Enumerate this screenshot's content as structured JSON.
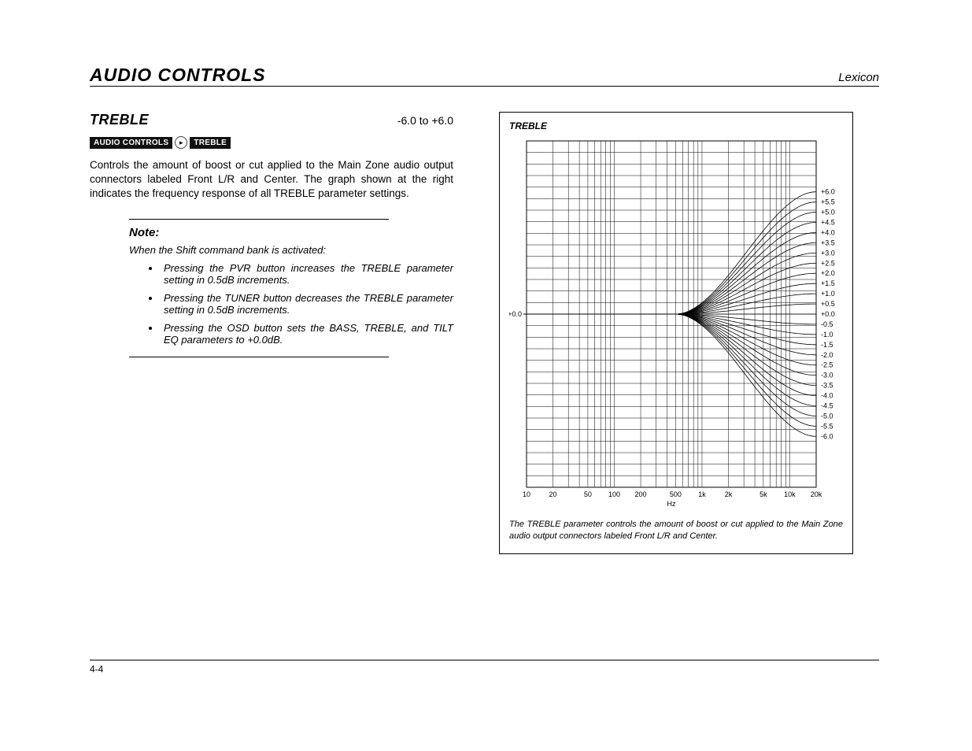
{
  "header": {
    "section": "AUDIO CONTROLS",
    "brand": "Lexicon"
  },
  "param": {
    "name": "TREBLE",
    "range": "-6.0 to +6.0"
  },
  "breadcrumb": {
    "a": "AUDIO CONTROLS",
    "arrow": "▸",
    "b": "TREBLE"
  },
  "body": "Controls the amount of boost or cut applied to the Main Zone audio output connectors labeled Front L/R and Center. The graph shown at the right indicates the frequency response of all TREBLE parameter settings.",
  "note": {
    "title": "Note:",
    "sub": "When the Shift command bank is activated:",
    "items": [
      "Pressing the PVR button increases the TREBLE parameter setting in 0.5dB increments.",
      "Pressing the TUNER button decreases the TREBLE parameter setting in 0.5dB increments.",
      "Pressing the OSD button sets the BASS, TREBLE, and TILT EQ parameters to +0.0dB."
    ]
  },
  "figure": {
    "title": "TREBLE",
    "caption": "The TREBLE parameter controls the amount of boost or cut applied to the Main Zone audio output connectors labeled Front L/R and Center."
  },
  "footer": {
    "page": "4-4"
  },
  "chart_data": {
    "type": "line",
    "title": "TREBLE",
    "xlabel": "Hz",
    "x_scale": "log",
    "x_ticks": [
      10,
      20,
      50,
      100,
      200,
      500,
      1000,
      2000,
      5000,
      10000,
      20000
    ],
    "x_tick_labels": [
      "10",
      "20",
      "50",
      "100",
      "200",
      "500",
      "1k",
      "2k",
      "5k",
      "10k",
      "20k"
    ],
    "xlim": [
      10,
      20000
    ],
    "ylabel": "",
    "left_y_tick": "+0.0",
    "right_y_ticks": [
      "+6.0",
      "+5.5",
      "+5.0",
      "+4.5",
      "+4.0",
      "+3.5",
      "+3.0",
      "+2.5",
      "+2.0",
      "+1.5",
      "+1.0",
      "+0.5",
      "+0.0",
      "-0.5",
      "-1.0",
      "-1.5",
      "-2.0",
      "-2.5",
      "-3.0",
      "-3.5",
      "-4.0",
      "-4.5",
      "-5.0",
      "-5.5",
      "-6.0"
    ],
    "ylim_db": [
      -6.0,
      6.0
    ],
    "series_description": "25 frequency-response curves corresponding to TREBLE settings from -6.0 dB to +6.0 dB in 0.5 dB steps. Each curve is ~0 dB below ~500 Hz and shelves to its setting value by 20 kHz.",
    "series": [
      {
        "name": "+6.0",
        "gain_at_20k_db": 6.0
      },
      {
        "name": "+5.5",
        "gain_at_20k_db": 5.5
      },
      {
        "name": "+5.0",
        "gain_at_20k_db": 5.0
      },
      {
        "name": "+4.5",
        "gain_at_20k_db": 4.5
      },
      {
        "name": "+4.0",
        "gain_at_20k_db": 4.0
      },
      {
        "name": "+3.5",
        "gain_at_20k_db": 3.5
      },
      {
        "name": "+3.0",
        "gain_at_20k_db": 3.0
      },
      {
        "name": "+2.5",
        "gain_at_20k_db": 2.5
      },
      {
        "name": "+2.0",
        "gain_at_20k_db": 2.0
      },
      {
        "name": "+1.5",
        "gain_at_20k_db": 1.5
      },
      {
        "name": "+1.0",
        "gain_at_20k_db": 1.0
      },
      {
        "name": "+0.5",
        "gain_at_20k_db": 0.5
      },
      {
        "name": "+0.0",
        "gain_at_20k_db": 0.0
      },
      {
        "name": "-0.5",
        "gain_at_20k_db": -0.5
      },
      {
        "name": "-1.0",
        "gain_at_20k_db": -1.0
      },
      {
        "name": "-1.5",
        "gain_at_20k_db": -1.5
      },
      {
        "name": "-2.0",
        "gain_at_20k_db": -2.0
      },
      {
        "name": "-2.5",
        "gain_at_20k_db": -2.5
      },
      {
        "name": "-3.0",
        "gain_at_20k_db": -3.0
      },
      {
        "name": "-3.5",
        "gain_at_20k_db": -3.5
      },
      {
        "name": "-4.0",
        "gain_at_20k_db": -4.0
      },
      {
        "name": "-4.5",
        "gain_at_20k_db": -4.5
      },
      {
        "name": "-5.0",
        "gain_at_20k_db": -5.0
      },
      {
        "name": "-5.5",
        "gain_at_20k_db": -5.5
      },
      {
        "name": "-6.0",
        "gain_at_20k_db": -6.0
      }
    ],
    "approx_knee_hz": 500
  }
}
